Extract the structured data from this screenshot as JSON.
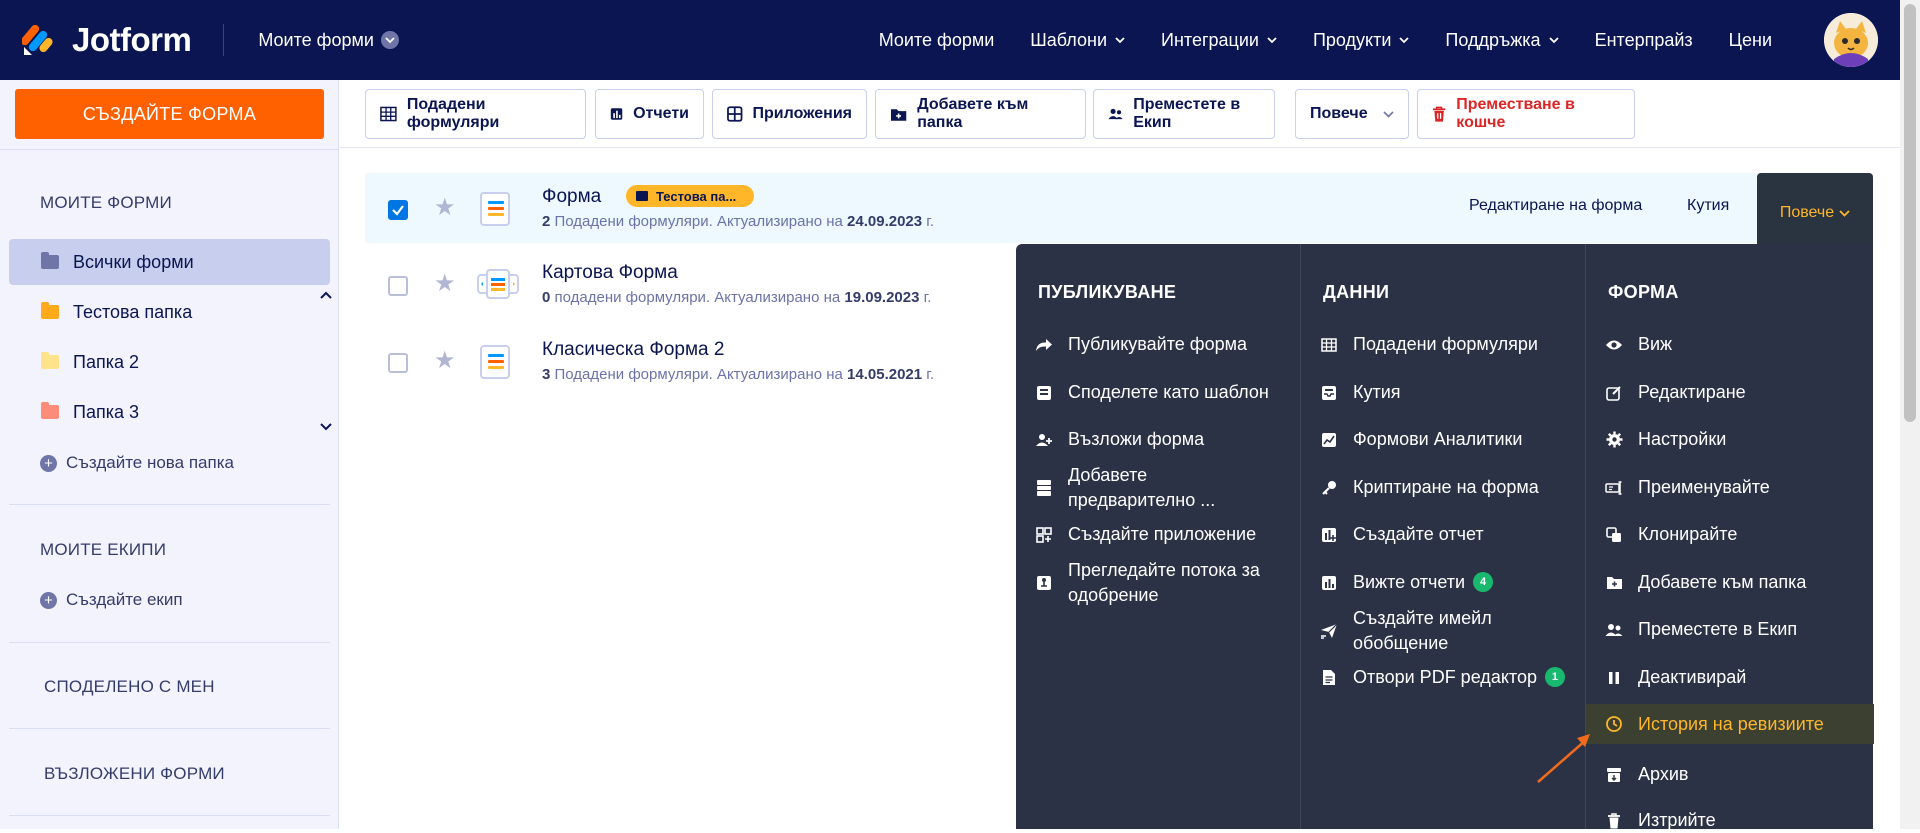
{
  "app": {
    "brand": "Jotform",
    "top_menu_label": "Моите форми"
  },
  "nav": {
    "items": [
      {
        "label": "Моите форми",
        "caret": false
      },
      {
        "label": "Шаблони",
        "caret": true
      },
      {
        "label": "Интеграции",
        "caret": true
      },
      {
        "label": "Продукти",
        "caret": true
      },
      {
        "label": "Поддръжка",
        "caret": true
      },
      {
        "label": "Ентерпрайз",
        "caret": false
      },
      {
        "label": "Цени",
        "caret": false
      }
    ]
  },
  "sidebar": {
    "create_button": "СЪЗДАЙТЕ ФОРМА",
    "my_forms_title": "МОИТЕ ФОРМИ",
    "folders": [
      {
        "label": "Всички форми",
        "color": "#6f76a7",
        "active": true
      },
      {
        "label": "Тестова папка",
        "color": "#ffa91b",
        "active": false
      },
      {
        "label": "Папка 2",
        "color": "#ffe38a",
        "active": false
      },
      {
        "label": "Папка 3",
        "color": "#fb8c7a",
        "active": false
      }
    ],
    "new_folder": "Създайте нова папка",
    "teams_title": "МОИТЕ ЕКИПИ",
    "new_team": "Създайте екип",
    "shared_title": "СПОДЕЛЕНО С МЕН",
    "assigned_title": "ВЪЗЛОЖЕНИ ФОРМИ"
  },
  "toolbar": {
    "submissions": "Подадени формуляри",
    "reports": "Отчети",
    "apps": "Приложения",
    "add_to_folder": "Добавете към папка",
    "move_to_team": "Преместете в Екип",
    "more": "Повече",
    "trash": "Преместване в кошче"
  },
  "forms": [
    {
      "title": "Форма",
      "folder_tag": "Тестова па...",
      "count": "2",
      "sub_text": " Подадени формуляри. Актуализирано на ",
      "date": "24.09.2023",
      "suffix": " г.",
      "checked": true
    },
    {
      "title": "Картова Форма",
      "count": "0",
      "sub_text": " подадени формуляри. Актуализирано на ",
      "date": "19.09.2023",
      "suffix": " г.",
      "checked": false
    },
    {
      "title": "Класическа Форма 2",
      "count": "3",
      "sub_text": " Подадени формуляри. Актуализирано на ",
      "date": "14.05.2021",
      "suffix": " г.",
      "checked": false
    }
  ],
  "row_actions": {
    "edit": "Редактиране на форма",
    "inbox": "Кутия",
    "more": "Повече"
  },
  "menu": {
    "publish": {
      "title": "ПУБЛИКУВАНЕ",
      "items": [
        {
          "label": "Публикувайте форма",
          "icon": "share-icon"
        },
        {
          "label": "Споделете като шаблон",
          "icon": "template-icon"
        },
        {
          "label": "Възложи форма",
          "icon": "assign-icon"
        },
        {
          "label_line1": "Добавете",
          "label_line2": "предварително ...",
          "icon": "prefill-icon"
        },
        {
          "label": "Създайте приложение",
          "icon": "create-app-icon"
        },
        {
          "label_line1": "Прегледайте потока за",
          "label_line2": "одобрение",
          "icon": "approval-icon"
        }
      ]
    },
    "data": {
      "title": "ДАННИ",
      "items": [
        {
          "label": "Подадени формуляри",
          "icon": "table-icon"
        },
        {
          "label": "Кутия",
          "icon": "inbox-icon"
        },
        {
          "label": "Формови Аналитики",
          "icon": "analytics-icon"
        },
        {
          "label": "Криптиране на форма",
          "icon": "key-icon"
        },
        {
          "label": "Създайте отчет",
          "icon": "report-create-icon"
        },
        {
          "label": "Вижте отчети",
          "icon": "report-icon",
          "badge": "4"
        },
        {
          "label_line1": "Създайте имейл",
          "label_line2": "обобщение",
          "icon": "email-icon"
        },
        {
          "label": "Отвори PDF редактор",
          "icon": "pdf-icon",
          "badge": "1"
        }
      ]
    },
    "form": {
      "title": "ФОРМА",
      "items": [
        {
          "label": "Виж",
          "icon": "eye-icon"
        },
        {
          "label": "Редактиране",
          "icon": "edit-icon"
        },
        {
          "label": "Настройки",
          "icon": "gear-icon"
        },
        {
          "label": "Преименувайте",
          "icon": "rename-icon"
        },
        {
          "label": "Клонирайте",
          "icon": "clone-icon"
        },
        {
          "label": "Добавете към папка",
          "icon": "folder-add-icon"
        },
        {
          "label": "Преместете в Екип",
          "icon": "team-icon"
        },
        {
          "label": "Деактивирай",
          "icon": "pause-icon"
        },
        {
          "label": "История на ревизиите",
          "icon": "history-icon",
          "highlighted": true
        },
        {
          "label": "Архив",
          "icon": "archive-icon"
        },
        {
          "label": "Изтрийте",
          "icon": "trash-icon"
        }
      ]
    }
  },
  "colors": {
    "navy": "#0a1551",
    "orange": "#ff6100",
    "menu_bg": "#2b3245",
    "highlight_text": "#ffb629",
    "annotation_arrow": "#f26b1d"
  }
}
